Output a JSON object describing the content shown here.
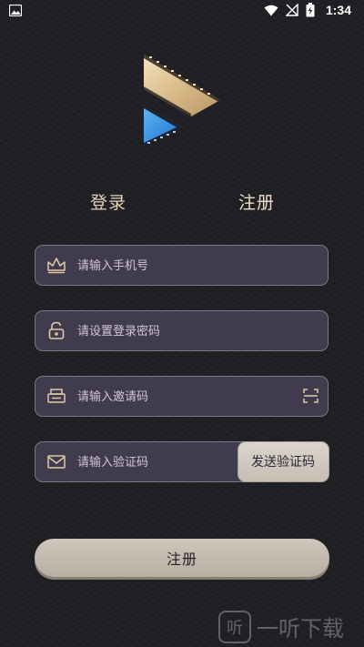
{
  "status_bar": {
    "time": "1:34",
    "left_icon": "image-icon",
    "right_icons": [
      "wifi-icon",
      "no-signal-icon",
      "battery-charging-icon"
    ]
  },
  "logo": {
    "icon": "play-film-logo"
  },
  "tabs": {
    "login": "登录",
    "register": "注册"
  },
  "form": {
    "phone": {
      "placeholder": "请输入手机号",
      "value": "",
      "icon": "crown-icon"
    },
    "password": {
      "placeholder": "请设置登录密码",
      "value": "",
      "icon": "lock-icon"
    },
    "invite": {
      "placeholder": "请输入邀请码",
      "value": "",
      "icon": "invite-card-icon",
      "scan_icon": "scan-icon"
    },
    "code": {
      "placeholder": "请输入验证码",
      "value": "",
      "icon": "mail-icon",
      "send_button": "发送验证码"
    }
  },
  "submit": {
    "label": "注册"
  },
  "watermark": {
    "badge": "听",
    "text": "一听下载"
  },
  "colors": {
    "background": "#1f1f24",
    "field_bg": "#413c4d",
    "field_border": "#7b7786",
    "accent_gold": "#e6d2b6",
    "button_bg": "#c6beb3"
  }
}
